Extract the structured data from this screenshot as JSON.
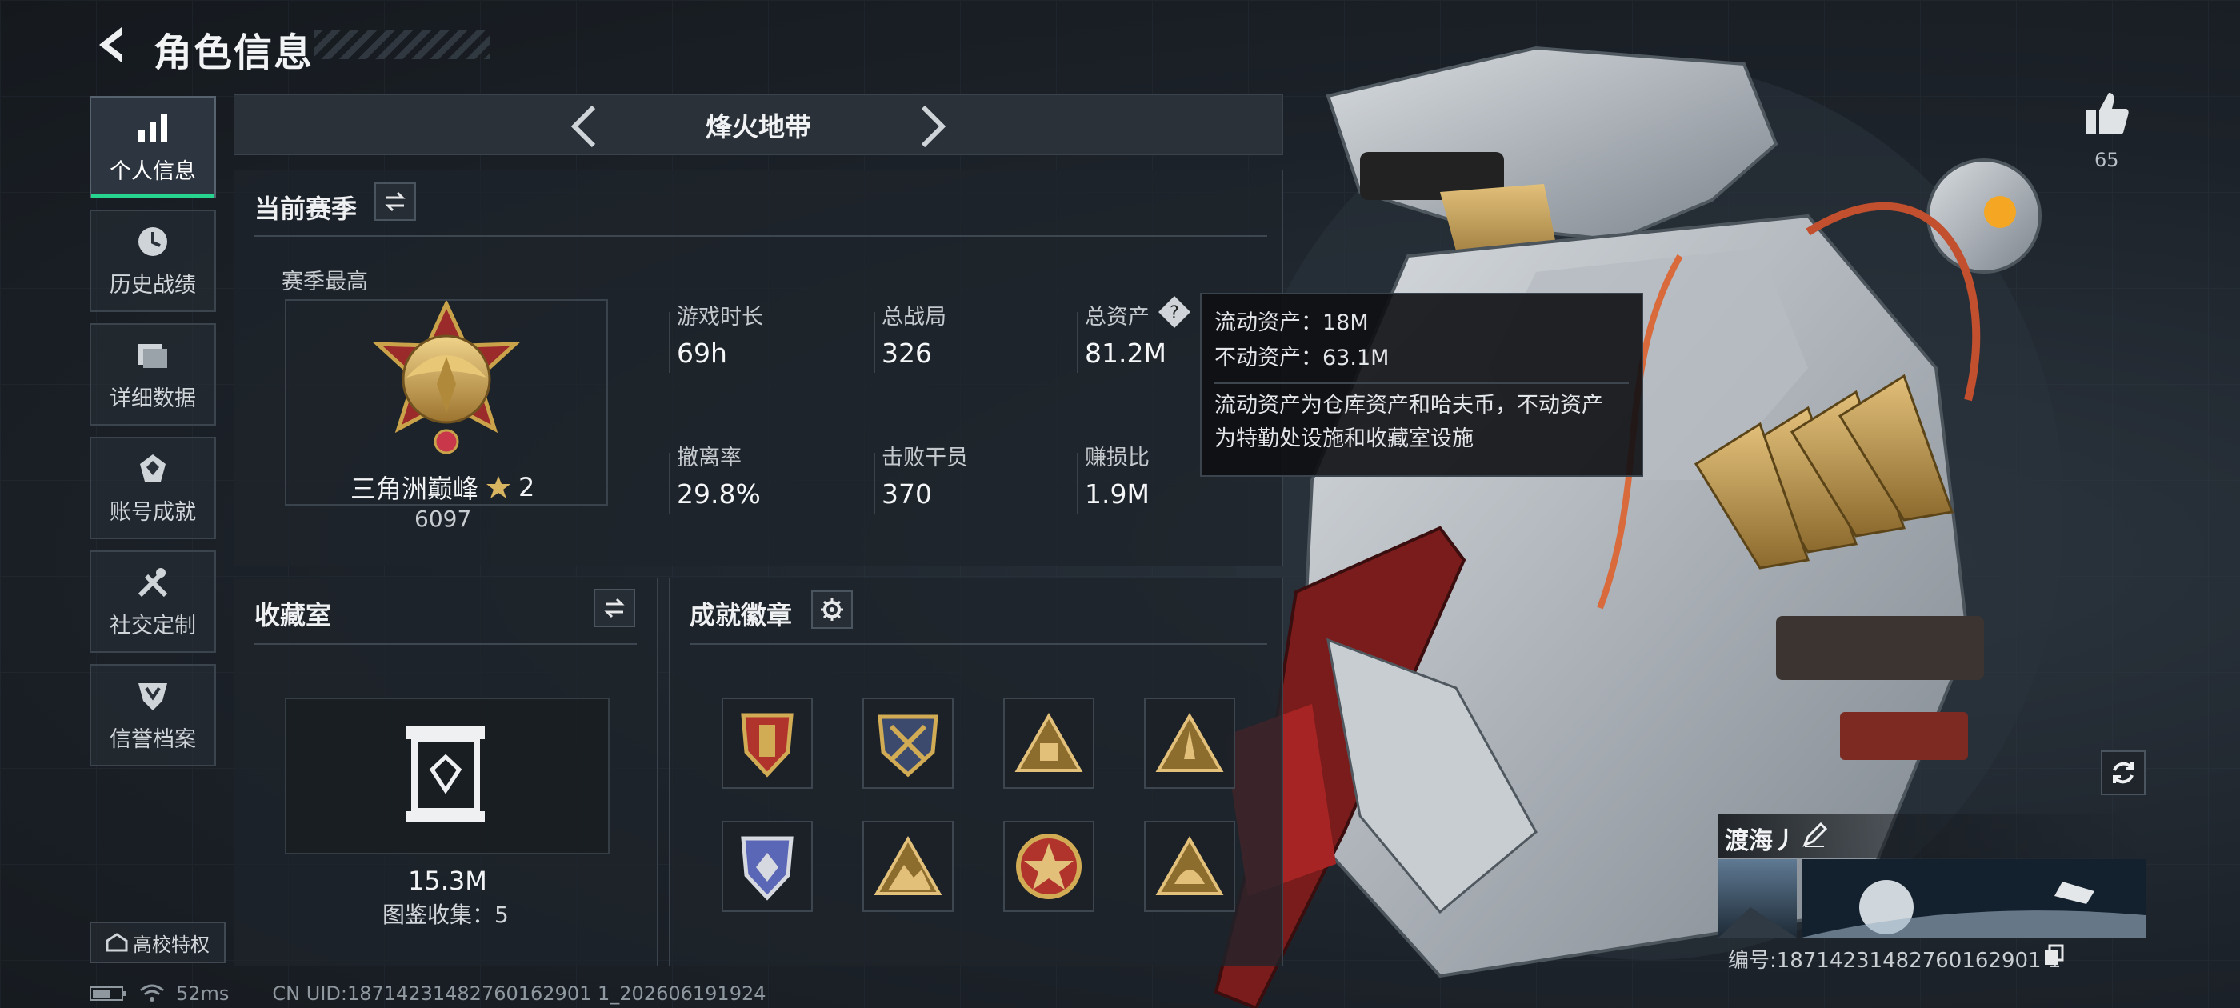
{
  "header": {
    "title": "角色信息"
  },
  "nav": {
    "items": [
      {
        "label": "个人信息",
        "icon": "bar-chart-icon",
        "active": true
      },
      {
        "label": "历史战绩",
        "icon": "clock-icon"
      },
      {
        "label": "详细数据",
        "icon": "folder-icon"
      },
      {
        "label": "账号成就",
        "icon": "achievement-icon"
      },
      {
        "label": "社交定制",
        "icon": "tools-icon"
      },
      {
        "label": "信誉档案",
        "icon": "shield-icon"
      }
    ],
    "campus_label": "高校特权"
  },
  "mode": {
    "title": "烽火地带"
  },
  "season": {
    "title": "当前赛季",
    "best_label": "赛季最高",
    "rank_name": "三角洲巅峰",
    "rank_stars": "2",
    "rank_score": "6097",
    "stats": [
      {
        "label": "游戏时长",
        "value": "69h"
      },
      {
        "label": "总战局",
        "value": "326"
      },
      {
        "label": "总资产",
        "value": "81.2M"
      },
      {
        "label": "撤离率",
        "value": "29.8%"
      },
      {
        "label": "击败干员",
        "value": "370"
      },
      {
        "label": "赚损比",
        "value": "1.9M"
      }
    ]
  },
  "tooltip": {
    "line1": "流动资产：18M",
    "line2": "不动资产：63.1M",
    "desc1": "流动资产为仓库资产和哈夫币，不动资产",
    "desc2": "为特勤处设施和收藏室设施"
  },
  "collection": {
    "title": "收藏室",
    "value": "15.3M",
    "catalog": "图鉴收集：5"
  },
  "achievements": {
    "title": "成就徽章",
    "badges": [
      "shield-badge-icon",
      "crossed-swords-badge-icon",
      "triangle-badge-icon",
      "rocket-badge-icon",
      "blue-shield-badge-icon",
      "mountain-badge-icon",
      "star-badge-icon",
      "helmet-badge-icon"
    ]
  },
  "player": {
    "likes": "65",
    "name": "渡海丿",
    "id": "编号:18714231482760162901 1"
  },
  "status": {
    "ping": "52ms",
    "uid": "CN UID:18714231482760162901 1_202606191924"
  },
  "colors": {
    "accent": "#27d48f",
    "gold": "#c9a24a"
  }
}
